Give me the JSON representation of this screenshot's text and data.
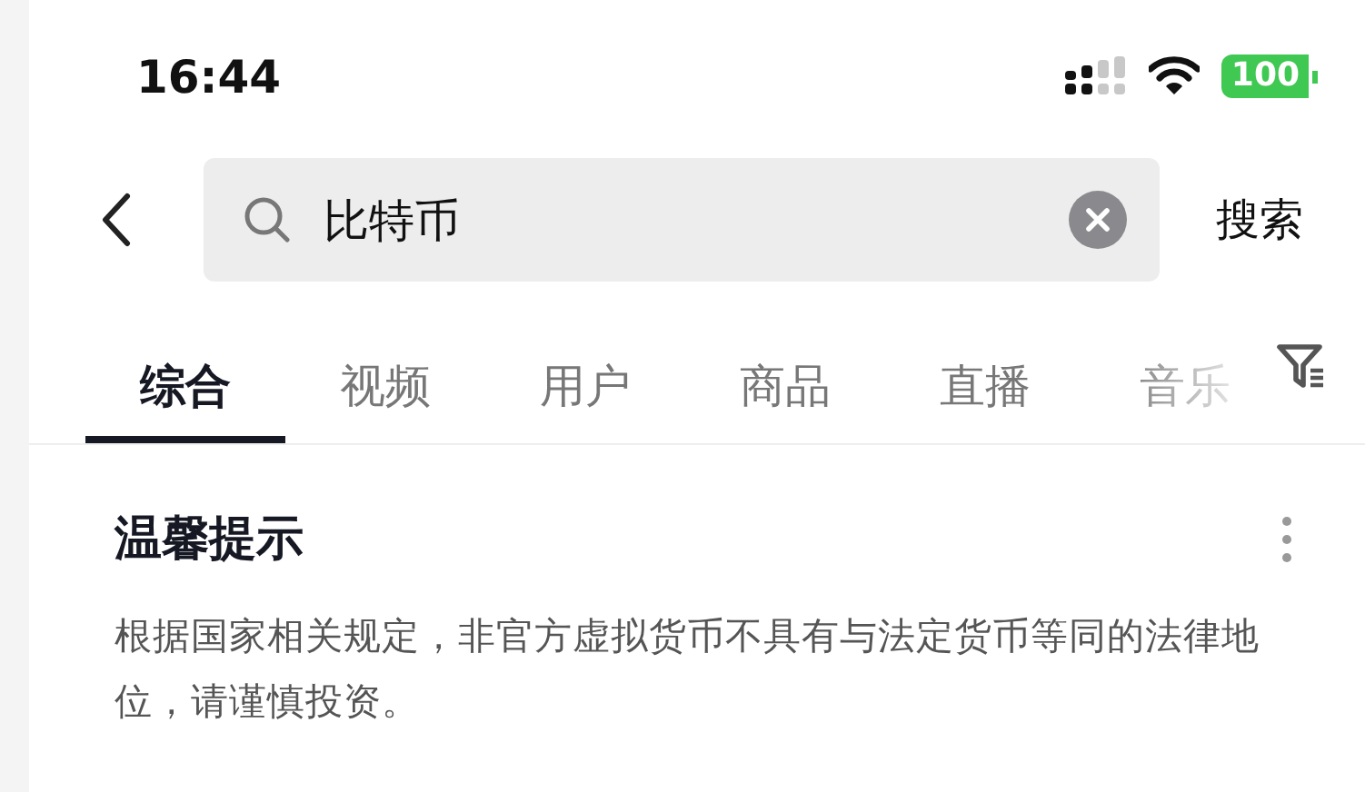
{
  "status_bar": {
    "time": "16:44",
    "battery": "100"
  },
  "search": {
    "value": "比特币",
    "action": "搜索"
  },
  "tabs": [
    {
      "label": "综合",
      "selected": true
    },
    {
      "label": "视频",
      "selected": false
    },
    {
      "label": "用户",
      "selected": false
    },
    {
      "label": "商品",
      "selected": false
    },
    {
      "label": "直播",
      "selected": false
    },
    {
      "label": "音乐",
      "selected": false
    }
  ],
  "notice": {
    "title": "温馨提示",
    "body": "根据国家相关规定，非官方虚拟货币不具有与法定货币等同的法律地位，请谨慎投资。"
  }
}
